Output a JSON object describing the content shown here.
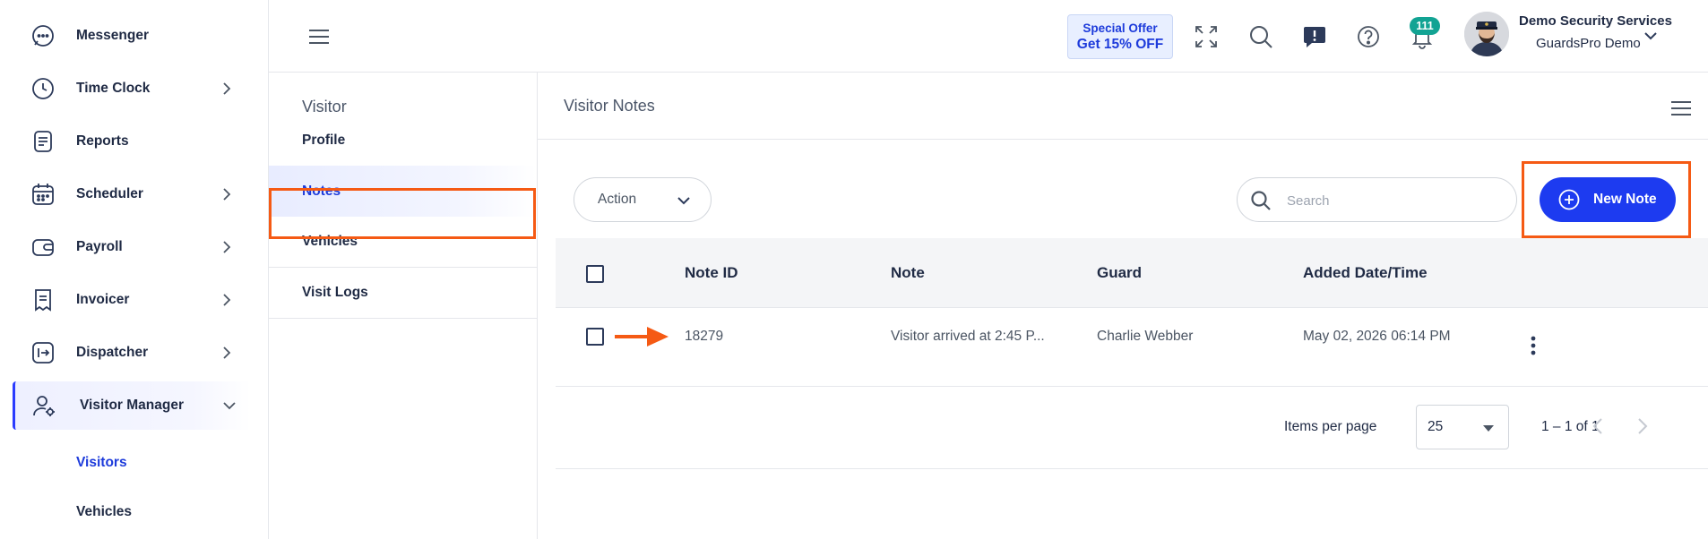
{
  "sidebar": {
    "items": [
      {
        "label": "Messenger",
        "icon": "chat-bubble-icon",
        "has_chevron": false
      },
      {
        "label": "Time Clock",
        "icon": "clock-icon",
        "has_chevron": true
      },
      {
        "label": "Reports",
        "icon": "report-icon",
        "has_chevron": false
      },
      {
        "label": "Scheduler",
        "icon": "calendar-icon",
        "has_chevron": true
      },
      {
        "label": "Payroll",
        "icon": "wallet-icon",
        "has_chevron": true
      },
      {
        "label": "Invoicer",
        "icon": "receipt-icon",
        "has_chevron": true
      },
      {
        "label": "Dispatcher",
        "icon": "dispatch-icon",
        "has_chevron": true
      },
      {
        "label": "Visitor Manager",
        "icon": "user-gear-icon",
        "has_chevron": true,
        "expanded": true,
        "active": true
      }
    ],
    "sub_items": [
      {
        "label": "Visitors",
        "selected": true
      },
      {
        "label": "Vehicles",
        "selected": false
      }
    ]
  },
  "header": {
    "offer": {
      "line1": "Special Offer",
      "line2": "Get 15% OFF"
    },
    "icons": [
      "fullscreen-icon",
      "search-icon",
      "feedback-icon",
      "help-icon",
      "bell-icon"
    ],
    "notification_count": "111",
    "user": {
      "name": "Demo Security Services",
      "org": "GuardsPro Demo"
    }
  },
  "subpanel": {
    "title": "Visitor",
    "items": [
      {
        "label": "Profile",
        "selected": false
      },
      {
        "label": "Notes",
        "selected": true
      },
      {
        "label": "Vehicles",
        "selected": false
      },
      {
        "label": "Visit Logs",
        "selected": false
      }
    ]
  },
  "main": {
    "title": "Visitor Notes",
    "action_label": "Action",
    "search_placeholder": "Search",
    "new_note_label": "New Note",
    "columns": [
      "Note ID",
      "Note",
      "Guard",
      "Added Date/Time"
    ],
    "rows": [
      {
        "note_id": "18279",
        "note": "Visitor arrived at 2:45 P...",
        "guard": "Charlie Webber",
        "added": "May 02, 2026 06:14 PM"
      }
    ],
    "pagination": {
      "items_per_page_label": "Items per page",
      "items_per_page": "25",
      "range": "1 – 1 of 1"
    }
  },
  "colors": {
    "accent": "#1d3bf0",
    "highlight": "#f55a14",
    "badge": "#12a393"
  }
}
